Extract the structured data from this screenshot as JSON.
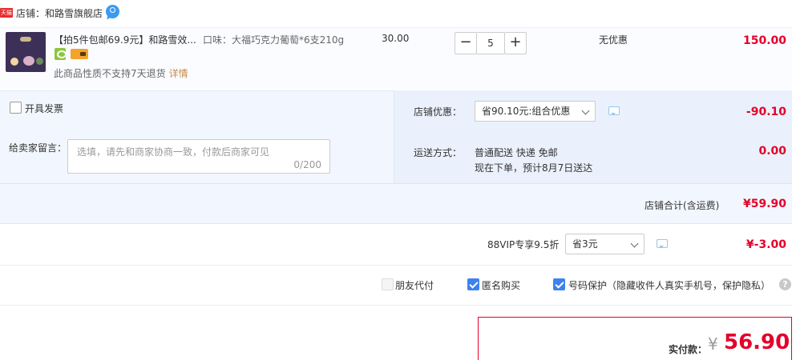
{
  "shop": {
    "logo_text": "天猫",
    "name": "店铺：和路雪旗舰店"
  },
  "item": {
    "title": "【拍5件包邮69.9元】和路雪效...",
    "spec": "口味：大福巧克力葡萄*6支210g",
    "unit_price": "30.00",
    "quantity": "5",
    "minus": "−",
    "plus": "+",
    "discount_status": "无优惠",
    "subtotal": "150.00",
    "return_note": "此商品性质不支持7天退货",
    "detail_link": "详情"
  },
  "options": {
    "invoice_label": "开具发票",
    "message_label": "给卖家留言：",
    "message_placeholder": "选填，请先和商家协商一致，付款后商家可见",
    "message_count": "0/200",
    "shop_discount_label": "店铺优惠：",
    "shop_discount_selected": "省90.10元:组合优惠",
    "shop_discount_amount": "-90.10",
    "shipping_label": "运送方式：",
    "shipping_line1": "普通配送 快递 免邮",
    "shipping_line2": "现在下单，预计8月7日送达",
    "shipping_amount": "0.00",
    "store_total_label": "店铺合计(含运费)",
    "store_total_amount": "¥59.90"
  },
  "vip": {
    "label": "88VIP专享9.5折",
    "selected": "省3元",
    "amount": "¥-3.00"
  },
  "checks": {
    "friend_pay": "朋友代付",
    "anonymous": "匿名购买",
    "phone_protect": "号码保护（隐藏收件人真实手机号，保护隐私）",
    "help": "?"
  },
  "payment": {
    "label": "实付款：",
    "currency": "¥",
    "amount": "56.90"
  },
  "colors": {
    "accent_red": "#e4002b",
    "panel_blue": "#f2f7ff",
    "check_blue": "#3c82f0"
  }
}
